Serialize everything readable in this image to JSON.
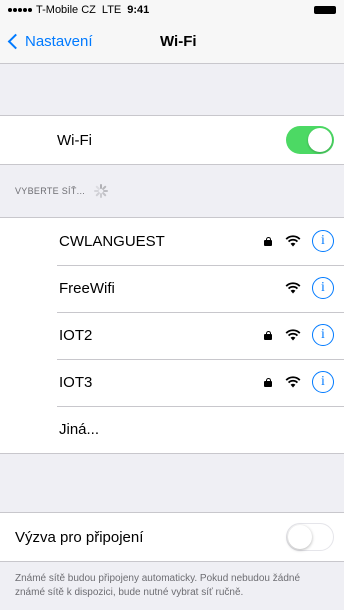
{
  "status_bar": {
    "carrier": "T-Mobile CZ",
    "network": "LTE",
    "time": "9:41"
  },
  "nav": {
    "back_label": "Nastavení",
    "title": "Wi-Fi"
  },
  "wifi_row": {
    "label": "Wi-Fi",
    "enabled": true
  },
  "networks_section": {
    "header": "VYBERTE SÍŤ..."
  },
  "networks": [
    {
      "name": "CWLANGUEST",
      "locked": true
    },
    {
      "name": "FreeWifi",
      "locked": false
    },
    {
      "name": "IOT2",
      "locked": true
    },
    {
      "name": "IOT3",
      "locked": true
    }
  ],
  "other_network": {
    "label": "Jiná..."
  },
  "ask_to_join": {
    "label": "Výzva pro připojení",
    "enabled": false
  },
  "footer_text": "Známé sítě budou připojeny automaticky. Pokud nebudou žádné známé sítě k dispozici, bude nutné vybrat síť ručně.",
  "colors": {
    "accent": "#007aff",
    "toggle_on": "#4cd964",
    "background": "#efeff4"
  }
}
